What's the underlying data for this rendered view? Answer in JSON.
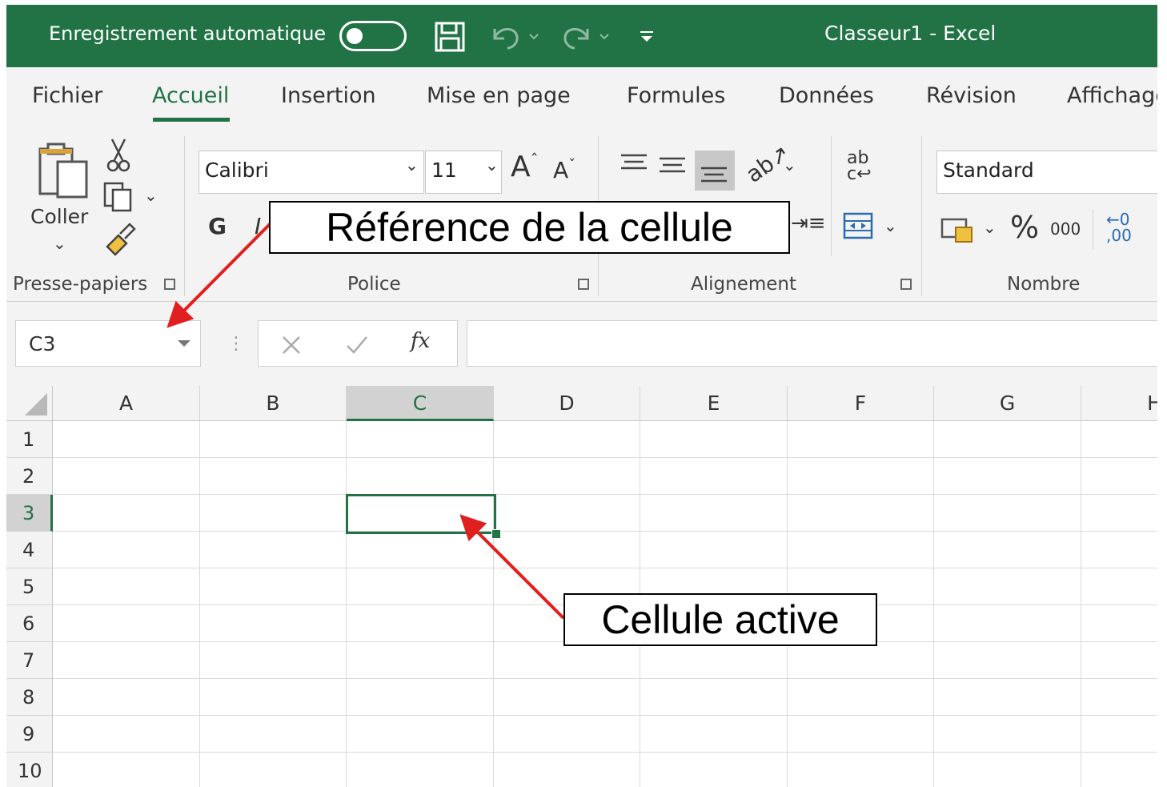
{
  "titlebar": {
    "autosave_label": "Enregistrement automatique",
    "title": "Classeur1  -  Excel",
    "bg_color": "#217346"
  },
  "tabs": [
    "Fichier",
    "Accueil",
    "Insertion",
    "Mise en page",
    "Formules",
    "Données",
    "Révision",
    "Affichage"
  ],
  "ribbon": {
    "clipboard": {
      "paste_label": "Coller",
      "group_label": "Presse-papiers"
    },
    "font": {
      "font_name": "Calibri",
      "font_size": "11",
      "bold_label": "G",
      "italic_label": "I",
      "group_label": "Police"
    },
    "alignment": {
      "group_label": "Alignement"
    },
    "number": {
      "format": "Standard",
      "percent": "%",
      "thousands": "000",
      "group_label": "Nombre"
    }
  },
  "formula_bar": {
    "name_box": "C3",
    "fx": "fx",
    "value": ""
  },
  "grid": {
    "columns": [
      "A",
      "B",
      "C",
      "D",
      "E",
      "F",
      "G",
      "H"
    ],
    "rows": [
      "1",
      "2",
      "3",
      "4",
      "5",
      "6",
      "7",
      "8",
      "9",
      "10"
    ],
    "active_cell": "C3",
    "accent_color": "#217346"
  },
  "callouts": {
    "reference": "Référence de la cellule",
    "active": "Cellule active",
    "arrow_color": "#e02020"
  }
}
